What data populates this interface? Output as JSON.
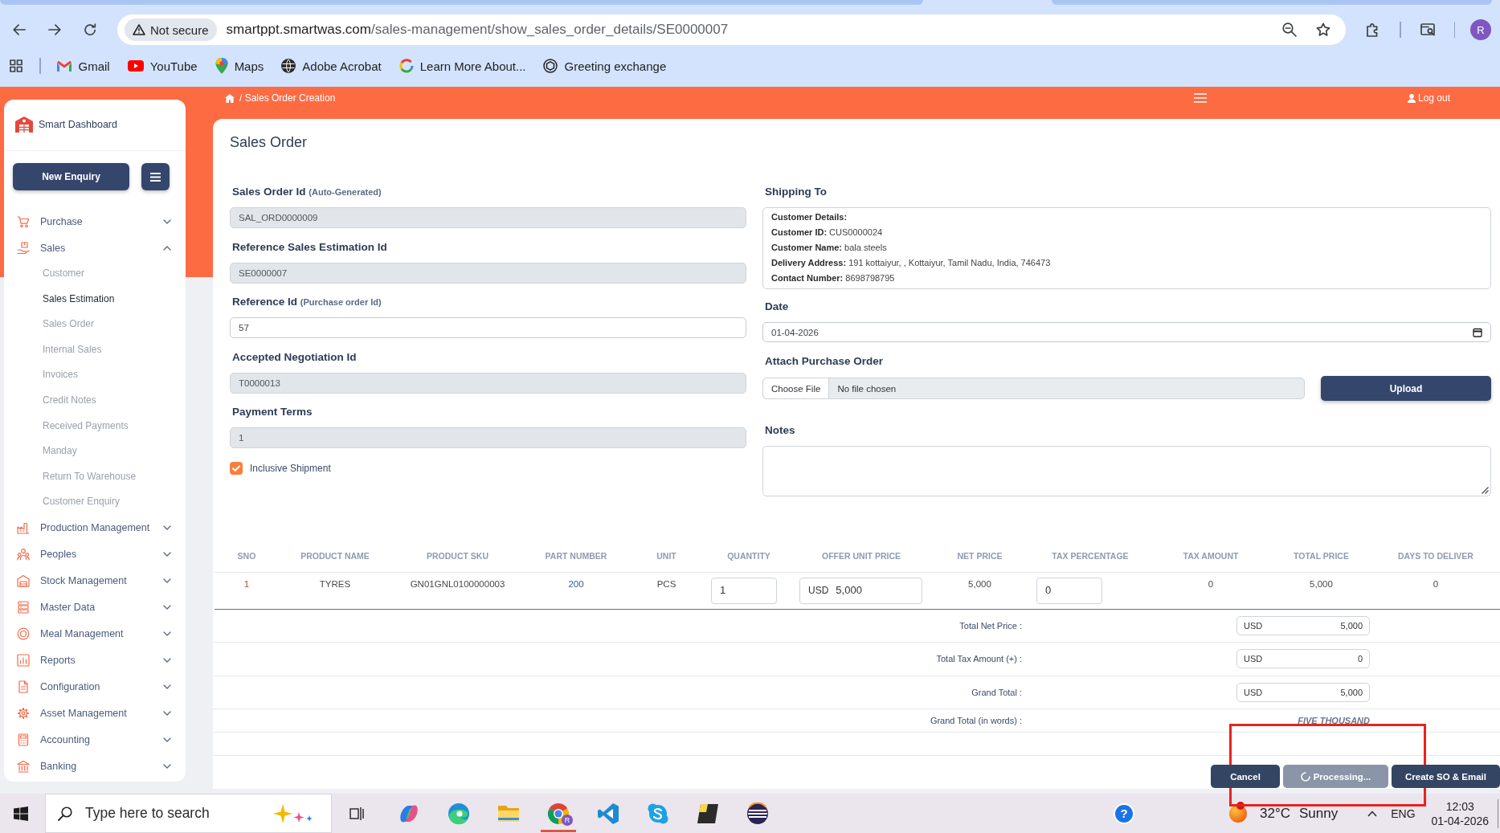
{
  "browser": {
    "security_label": "Not secure",
    "url_host": "smartppt.smartwas.com",
    "url_path": "/sales-management/show_sales_order_details/SE0000007",
    "profile_initial": "R",
    "bookmarks": [
      "Gmail",
      "YouTube",
      "Maps",
      "Adobe Acrobat",
      "Learn More About...",
      "Greeting exchange"
    ]
  },
  "header": {
    "breadcrumb": "/ Sales Order Creation",
    "logout": "Log out"
  },
  "sidebar": {
    "brand": "Smart Dashboard",
    "new_button": "New Enquiry",
    "items": [
      {
        "label": "Purchase",
        "expanded": false
      },
      {
        "label": "Sales",
        "expanded": true,
        "children": [
          {
            "label": "Customer",
            "selected": false
          },
          {
            "label": "Sales Estimation",
            "selected": true
          },
          {
            "label": "Sales Order",
            "selected": false
          },
          {
            "label": "Internal Sales",
            "selected": false
          },
          {
            "label": "Invoices",
            "selected": false
          },
          {
            "label": "Credit Notes",
            "selected": false
          },
          {
            "label": "Received Payments",
            "selected": false
          },
          {
            "label": "Manday",
            "selected": false
          },
          {
            "label": "Return To Warehouse",
            "selected": false
          },
          {
            "label": "Customer Enquiry",
            "selected": false
          }
        ]
      },
      {
        "label": "Production Management",
        "expanded": false
      },
      {
        "label": "Peoples",
        "expanded": false
      },
      {
        "label": "Stock Management",
        "expanded": false
      },
      {
        "label": "Master Data",
        "expanded": false
      },
      {
        "label": "Meal Management",
        "expanded": false
      },
      {
        "label": "Reports",
        "expanded": false
      },
      {
        "label": "Configuration",
        "expanded": false
      },
      {
        "label": "Asset Management",
        "expanded": false
      },
      {
        "label": "Accounting",
        "expanded": false
      },
      {
        "label": "Banking",
        "expanded": false
      }
    ]
  },
  "page": {
    "title": "Sales Order"
  },
  "form": {
    "fields": [
      {
        "label": "Sales Order Id",
        "hint": "(Auto-Generated)",
        "value": "SAL_ORD0000009",
        "disabled": true
      },
      {
        "label": "Reference Sales Estimation Id",
        "value": "SE0000007",
        "disabled": true
      },
      {
        "label": "Reference Id",
        "hint": "(Purchase order Id)",
        "value": "57",
        "disabled": false
      },
      {
        "label": "Accepted Negotiation Id",
        "value": "T0000013",
        "disabled": true
      },
      {
        "label": "Payment Terms",
        "value": "1",
        "disabled": true
      }
    ],
    "inclusive_shipment": {
      "label": "Inclusive Shipment",
      "checked": true
    },
    "shipping": {
      "label": "Shipping To",
      "heading": "Customer Details:",
      "lines": [
        {
          "label": "Customer ID:",
          "value": "CUS0000024"
        },
        {
          "label": "Customer Name:",
          "value": "bala steels"
        },
        {
          "label": "Delivery Address:",
          "value": "191 kottaiyur, , Kottaiyur, Tamil Nadu, India, 746473"
        },
        {
          "label": "Contact Number:",
          "value": "8698798795"
        }
      ]
    },
    "date": {
      "label": "Date",
      "value": "01-04-2026"
    },
    "attachment": {
      "label": "Attach Purchase Order",
      "choose_button": "Choose File",
      "status": "No file chosen",
      "upload_button": "Upload"
    },
    "notes": {
      "label": "Notes"
    }
  },
  "table": {
    "columns": [
      "SNO",
      "PRODUCT NAME",
      "PRODUCT SKU",
      "PART NUMBER",
      "UNIT",
      "QUANTITY",
      "OFFER UNIT PRICE",
      "NET PRICE",
      "TAX PERCENTAGE",
      "TAX AMOUNT",
      "TOTAL PRICE",
      "DAYS TO DELIVER"
    ],
    "rows": [
      {
        "cells": [
          {
            "kind": "text",
            "value": "1"
          },
          {
            "kind": "text",
            "value": "TYRES"
          },
          {
            "kind": "text",
            "value": "GN01GNL0100000003"
          },
          {
            "kind": "text",
            "value": "200"
          },
          {
            "kind": "text",
            "value": "PCS"
          },
          {
            "kind": "input",
            "value": "1"
          },
          {
            "kind": "currency_input",
            "currency": "USD",
            "value": "5,000"
          },
          {
            "kind": "text",
            "value": "5,000"
          },
          {
            "kind": "input",
            "value": "0"
          },
          {
            "kind": "text",
            "value": "0"
          },
          {
            "kind": "text",
            "value": "5,000"
          },
          {
            "kind": "text",
            "value": "0"
          }
        ]
      }
    ]
  },
  "totals": [
    {
      "label": "Total Net Price :",
      "currency": "USD",
      "value": "5,000"
    },
    {
      "label": "Total Tax Amount (+) :",
      "currency": "USD",
      "value": "0"
    },
    {
      "label": "Grand Total :",
      "currency": "USD",
      "value": "5,000"
    }
  ],
  "total_in_words": {
    "label": "Grand Total (in words) :",
    "value": "FIVE THOUSAND"
  },
  "actions": [
    {
      "label": "Cancel",
      "kind": "cancel",
      "disabled": false
    },
    {
      "label": "Processing...",
      "kind": "loading",
      "disabled": true
    },
    {
      "label": "Create SO & Email",
      "kind": "submit",
      "disabled": false
    }
  ],
  "annotations": [
    {
      "kind": "rectangle"
    }
  ],
  "taskbar": {
    "search_placeholder": "Type here to search",
    "apps": [
      {
        "selected": false
      },
      {
        "selected": false
      },
      {
        "selected": false
      },
      {
        "selected": true,
        "badge": "R"
      },
      {
        "selected": false
      },
      {
        "selected": false
      },
      {
        "selected": false
      },
      {
        "selected": false
      }
    ],
    "help": "?",
    "temperature": "32°C",
    "condition": "Sunny",
    "language": "ENG",
    "time": "12:03",
    "date": "01-04-2026"
  }
}
